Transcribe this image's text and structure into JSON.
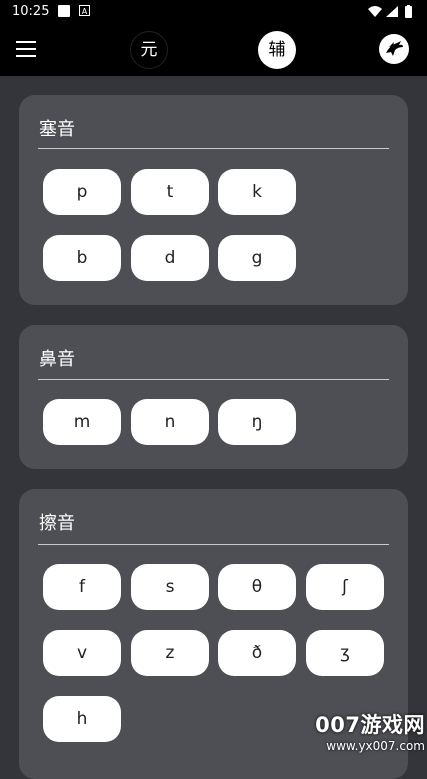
{
  "status_bar": {
    "time": "10:25",
    "notif_icon_letter": "A"
  },
  "app_bar": {
    "tab_yuan": "元",
    "tab_fu": "辅"
  },
  "sections": [
    {
      "title": "塞音",
      "keys": [
        "p",
        "t",
        "k",
        "b",
        "d",
        "g"
      ]
    },
    {
      "title": "鼻音",
      "keys": [
        "m",
        "n",
        "ŋ"
      ]
    },
    {
      "title": "擦音",
      "keys": [
        "f",
        "s",
        "θ",
        "ʃ",
        "v",
        "z",
        "ð",
        "ʒ",
        "h"
      ]
    }
  ],
  "watermark": {
    "line1": "007游戏网",
    "line2": "www.yx007.com"
  }
}
